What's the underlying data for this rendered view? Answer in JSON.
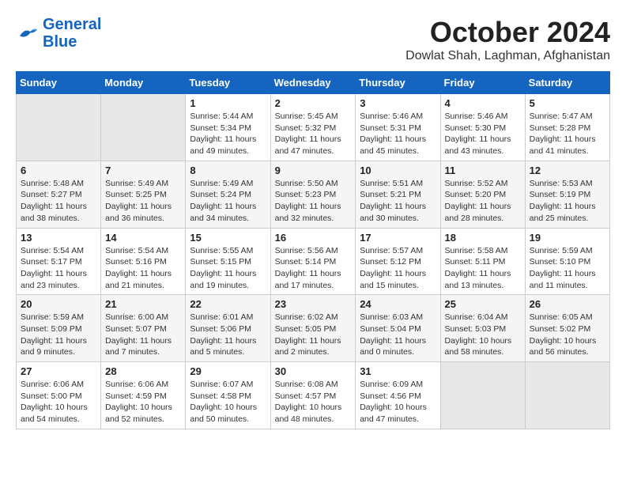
{
  "logo": {
    "line1": "General",
    "line2": "Blue"
  },
  "title": "October 2024",
  "location": "Dowlat Shah, Laghman, Afghanistan",
  "headers": [
    "Sunday",
    "Monday",
    "Tuesday",
    "Wednesday",
    "Thursday",
    "Friday",
    "Saturday"
  ],
  "weeks": [
    [
      {
        "day": "",
        "info": ""
      },
      {
        "day": "",
        "info": ""
      },
      {
        "day": "1",
        "info": "Sunrise: 5:44 AM\nSunset: 5:34 PM\nDaylight: 11 hours and 49 minutes."
      },
      {
        "day": "2",
        "info": "Sunrise: 5:45 AM\nSunset: 5:32 PM\nDaylight: 11 hours and 47 minutes."
      },
      {
        "day": "3",
        "info": "Sunrise: 5:46 AM\nSunset: 5:31 PM\nDaylight: 11 hours and 45 minutes."
      },
      {
        "day": "4",
        "info": "Sunrise: 5:46 AM\nSunset: 5:30 PM\nDaylight: 11 hours and 43 minutes."
      },
      {
        "day": "5",
        "info": "Sunrise: 5:47 AM\nSunset: 5:28 PM\nDaylight: 11 hours and 41 minutes."
      }
    ],
    [
      {
        "day": "6",
        "info": "Sunrise: 5:48 AM\nSunset: 5:27 PM\nDaylight: 11 hours and 38 minutes."
      },
      {
        "day": "7",
        "info": "Sunrise: 5:49 AM\nSunset: 5:25 PM\nDaylight: 11 hours and 36 minutes."
      },
      {
        "day": "8",
        "info": "Sunrise: 5:49 AM\nSunset: 5:24 PM\nDaylight: 11 hours and 34 minutes."
      },
      {
        "day": "9",
        "info": "Sunrise: 5:50 AM\nSunset: 5:23 PM\nDaylight: 11 hours and 32 minutes."
      },
      {
        "day": "10",
        "info": "Sunrise: 5:51 AM\nSunset: 5:21 PM\nDaylight: 11 hours and 30 minutes."
      },
      {
        "day": "11",
        "info": "Sunrise: 5:52 AM\nSunset: 5:20 PM\nDaylight: 11 hours and 28 minutes."
      },
      {
        "day": "12",
        "info": "Sunrise: 5:53 AM\nSunset: 5:19 PM\nDaylight: 11 hours and 25 minutes."
      }
    ],
    [
      {
        "day": "13",
        "info": "Sunrise: 5:54 AM\nSunset: 5:17 PM\nDaylight: 11 hours and 23 minutes."
      },
      {
        "day": "14",
        "info": "Sunrise: 5:54 AM\nSunset: 5:16 PM\nDaylight: 11 hours and 21 minutes."
      },
      {
        "day": "15",
        "info": "Sunrise: 5:55 AM\nSunset: 5:15 PM\nDaylight: 11 hours and 19 minutes."
      },
      {
        "day": "16",
        "info": "Sunrise: 5:56 AM\nSunset: 5:14 PM\nDaylight: 11 hours and 17 minutes."
      },
      {
        "day": "17",
        "info": "Sunrise: 5:57 AM\nSunset: 5:12 PM\nDaylight: 11 hours and 15 minutes."
      },
      {
        "day": "18",
        "info": "Sunrise: 5:58 AM\nSunset: 5:11 PM\nDaylight: 11 hours and 13 minutes."
      },
      {
        "day": "19",
        "info": "Sunrise: 5:59 AM\nSunset: 5:10 PM\nDaylight: 11 hours and 11 minutes."
      }
    ],
    [
      {
        "day": "20",
        "info": "Sunrise: 5:59 AM\nSunset: 5:09 PM\nDaylight: 11 hours and 9 minutes."
      },
      {
        "day": "21",
        "info": "Sunrise: 6:00 AM\nSunset: 5:07 PM\nDaylight: 11 hours and 7 minutes."
      },
      {
        "day": "22",
        "info": "Sunrise: 6:01 AM\nSunset: 5:06 PM\nDaylight: 11 hours and 5 minutes."
      },
      {
        "day": "23",
        "info": "Sunrise: 6:02 AM\nSunset: 5:05 PM\nDaylight: 11 hours and 2 minutes."
      },
      {
        "day": "24",
        "info": "Sunrise: 6:03 AM\nSunset: 5:04 PM\nDaylight: 11 hours and 0 minutes."
      },
      {
        "day": "25",
        "info": "Sunrise: 6:04 AM\nSunset: 5:03 PM\nDaylight: 10 hours and 58 minutes."
      },
      {
        "day": "26",
        "info": "Sunrise: 6:05 AM\nSunset: 5:02 PM\nDaylight: 10 hours and 56 minutes."
      }
    ],
    [
      {
        "day": "27",
        "info": "Sunrise: 6:06 AM\nSunset: 5:00 PM\nDaylight: 10 hours and 54 minutes."
      },
      {
        "day": "28",
        "info": "Sunrise: 6:06 AM\nSunset: 4:59 PM\nDaylight: 10 hours and 52 minutes."
      },
      {
        "day": "29",
        "info": "Sunrise: 6:07 AM\nSunset: 4:58 PM\nDaylight: 10 hours and 50 minutes."
      },
      {
        "day": "30",
        "info": "Sunrise: 6:08 AM\nSunset: 4:57 PM\nDaylight: 10 hours and 48 minutes."
      },
      {
        "day": "31",
        "info": "Sunrise: 6:09 AM\nSunset: 4:56 PM\nDaylight: 10 hours and 47 minutes."
      },
      {
        "day": "",
        "info": ""
      },
      {
        "day": "",
        "info": ""
      }
    ]
  ]
}
